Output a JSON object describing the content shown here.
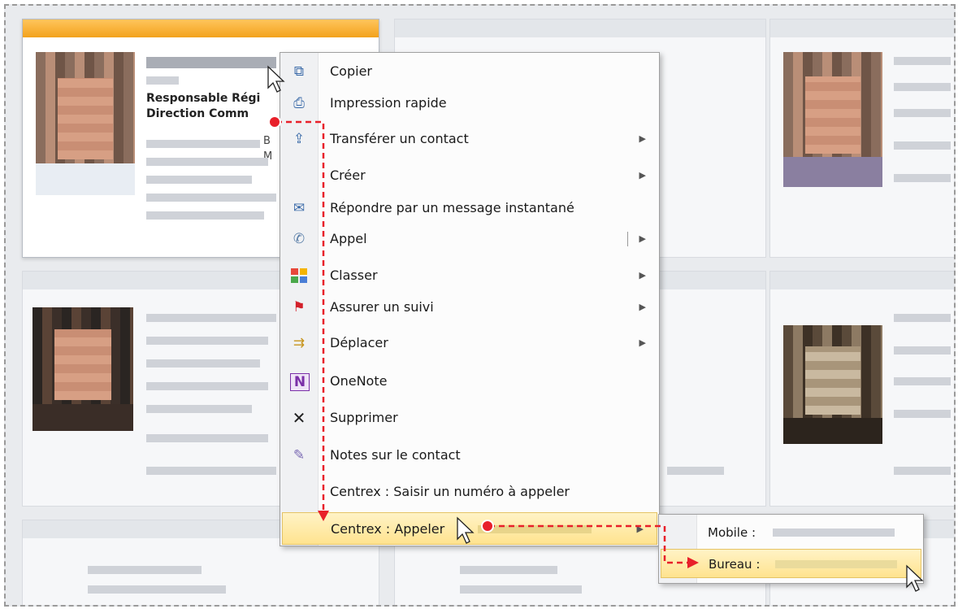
{
  "card": {
    "title_line1": "Responsable Régi",
    "title_line2": "Direction Comm",
    "partial_text_1": "B",
    "partial_text_2": "M"
  },
  "context_menu": {
    "items": [
      {
        "label": "Copier",
        "icon": "copy-icon",
        "glyph": "⧉",
        "submenu": false
      },
      {
        "label": "Impression rapide",
        "icon": "print-icon",
        "glyph": "⎙",
        "submenu": false
      },
      {
        "label": "Transférer un contact",
        "icon": "forward-contact-icon",
        "glyph": "⇪",
        "submenu": true
      },
      {
        "label": "Créer",
        "icon": "",
        "glyph": "",
        "submenu": true
      },
      {
        "label": "Répondre par un message instantané",
        "icon": "instant-message-icon",
        "glyph": "✉",
        "submenu": false
      },
      {
        "label": "Appel",
        "icon": "phone-icon",
        "glyph": "✆",
        "submenu": true
      },
      {
        "label": "Classer",
        "icon": "categorize-icon",
        "glyph": "",
        "submenu": true
      },
      {
        "label": "Assurer un suivi",
        "icon": "flag-icon",
        "glyph": "⚑",
        "submenu": true
      },
      {
        "label": "Déplacer",
        "icon": "move-folder-icon",
        "glyph": "⇉",
        "submenu": true
      },
      {
        "label": "OneNote",
        "icon": "onenote-icon",
        "glyph": "N",
        "submenu": false
      },
      {
        "label": "Supprimer",
        "icon": "delete-icon",
        "glyph": "✕",
        "submenu": false
      },
      {
        "label": "Notes sur le contact",
        "icon": "contact-notes-icon",
        "glyph": "✎",
        "submenu": false
      },
      {
        "label": "Centrex : Saisir un numéro à appeler",
        "icon": "",
        "glyph": "",
        "submenu": false
      },
      {
        "label": "Centrex : Appeler",
        "icon": "",
        "glyph": "",
        "submenu": true
      }
    ]
  },
  "submenu": {
    "items": [
      {
        "label": "Mobile :"
      },
      {
        "label": "Bureau :"
      }
    ]
  },
  "colors": {
    "highlight": "#ffe38f",
    "annotation": "#e8202a",
    "selected_card_header": "#f3a21c"
  }
}
